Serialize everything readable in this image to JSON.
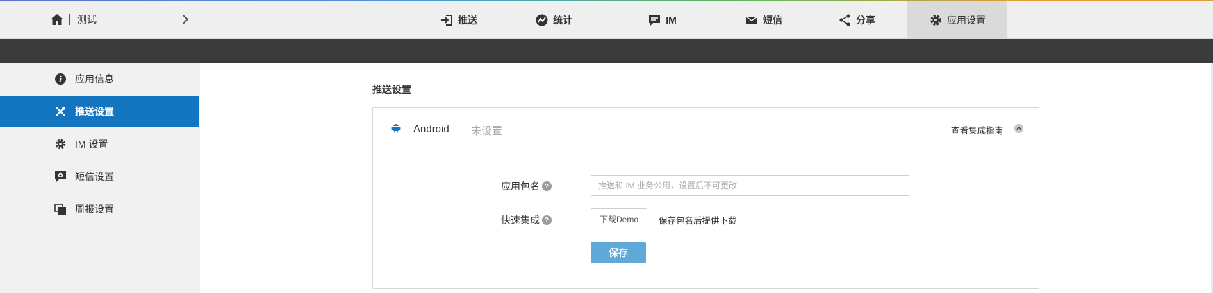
{
  "header": {
    "app_name": "测试",
    "home_icon": "home-icon",
    "switch_icon": "chevron-right-icon"
  },
  "nav": [
    {
      "label": "推送",
      "icon": "sign-in-icon"
    },
    {
      "label": "统计",
      "icon": "chart-icon"
    },
    {
      "label": "IM",
      "icon": "chat-icon"
    },
    {
      "label": "短信",
      "icon": "envelope-icon"
    },
    {
      "label": "分享",
      "icon": "share-icon"
    },
    {
      "label": "应用设置",
      "icon": "gear-icon",
      "active": true
    }
  ],
  "sidebar": {
    "items": [
      {
        "label": "应用信息",
        "icon": "info-icon"
      },
      {
        "label": "推送设置",
        "icon": "wrench-icon",
        "active": true
      },
      {
        "label": "IM 设置",
        "icon": "cog-icon"
      },
      {
        "label": "短信设置",
        "icon": "message-settings-icon"
      },
      {
        "label": "周报设置",
        "icon": "report-icon"
      }
    ]
  },
  "main": {
    "section_title": "推送设置",
    "platform": "Android",
    "platform_icon": "android-icon",
    "status": "未设置",
    "guide_link": "查看集成指南",
    "collapse_icon": "chevron-up-icon",
    "form": {
      "package_label": "应用包名",
      "package_placeholder": "推送和 IM 业务公用，设置后不可更改",
      "package_value": "",
      "quick_label": "快速集成",
      "download_button": "下载Demo",
      "download_hint": "保存包名后提供下载",
      "help_mark": "?",
      "save_button": "保存"
    }
  },
  "colors": {
    "accent_blue": "#1375c0",
    "save_button": "#5fa8d8",
    "dark_bar": "#3b3b3b",
    "nav_active": "#dadada"
  }
}
